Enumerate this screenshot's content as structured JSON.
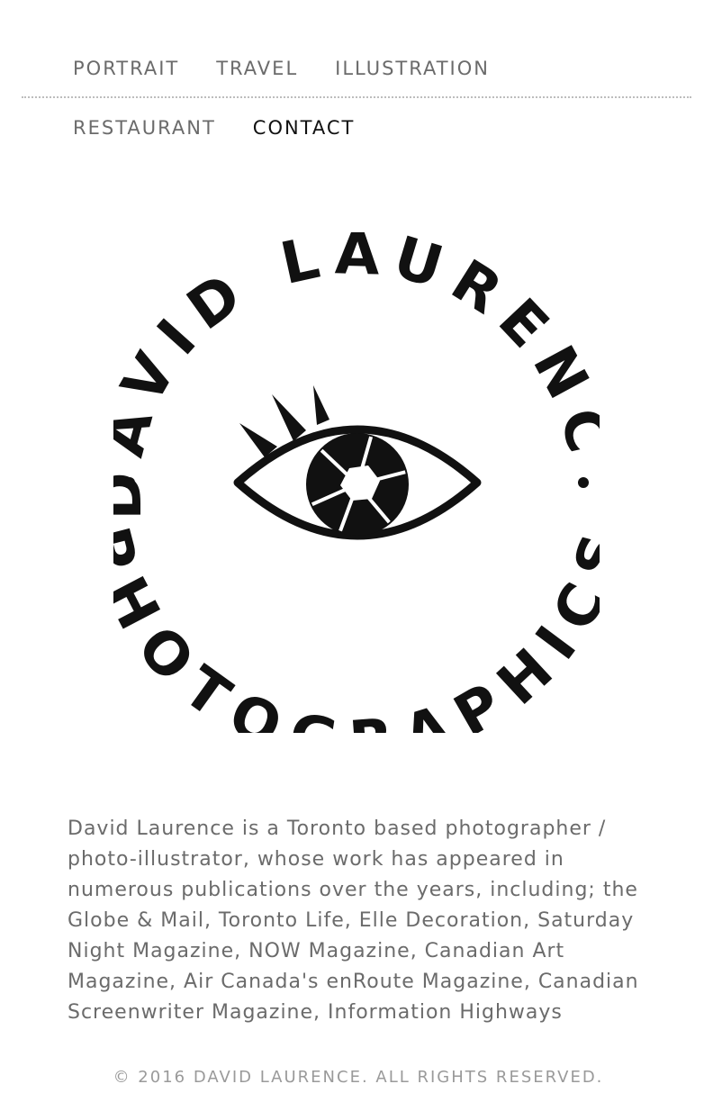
{
  "nav": {
    "items": [
      {
        "label": "PORTRAIT",
        "active": false
      },
      {
        "label": "TRAVEL",
        "active": false
      },
      {
        "label": "ILLUSTRATION",
        "active": false
      },
      {
        "label": "RESTAURANT",
        "active": false
      },
      {
        "label": "CONTACT",
        "active": true
      }
    ]
  },
  "logo": {
    "top_text": "DAVID LAURENCE",
    "bottom_text": "PHOTOGRAPHICS",
    "icon": "eye-aperture-icon",
    "color": "#111111"
  },
  "bio": {
    "text": "David Laurence is a Toronto based photographer / photo-illustrator, whose work has appeared in numerous publications over the years, including; the Globe & Mail, Toronto Life, Elle Decoration, Saturday Night Magazine, NOW Magazine, Canadian Art Magazine, Air Canada's enRoute Magazine, Canadian Screenwriter Magazine, Information Highways"
  },
  "footer": {
    "text": "© 2016 DAVID LAURENCE. ALL RIGHTS RESERVED."
  },
  "colors": {
    "nav_text": "#6b6b6b",
    "nav_active": "#111111",
    "body_text": "#6b6b6b",
    "footer_text": "#9a9a9a"
  }
}
